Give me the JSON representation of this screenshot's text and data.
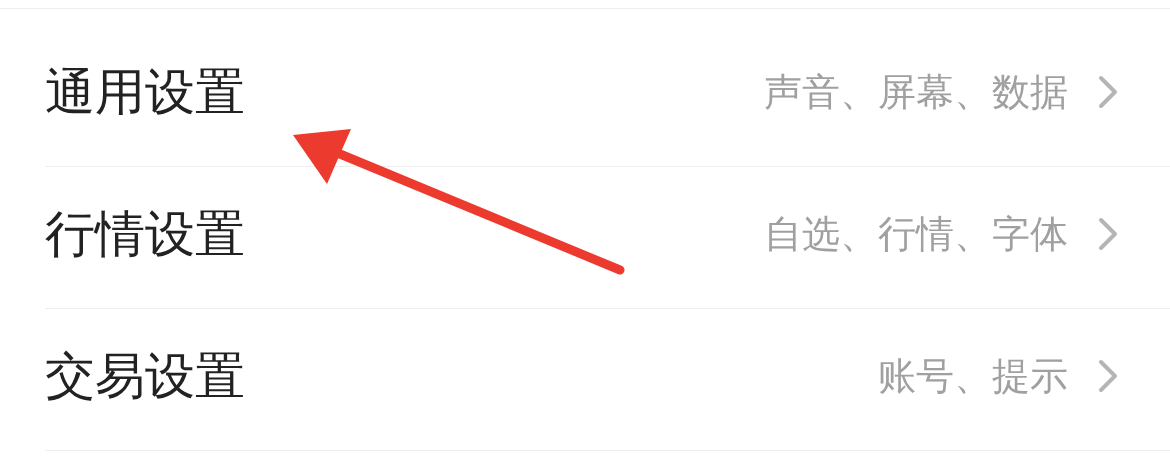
{
  "settings": [
    {
      "title": "通用设置",
      "summary": "声音、屏幕、数据"
    },
    {
      "title": "行情设置",
      "summary": "自选、行情、字体"
    },
    {
      "title": "交易设置",
      "summary": "账号、提示"
    }
  ]
}
